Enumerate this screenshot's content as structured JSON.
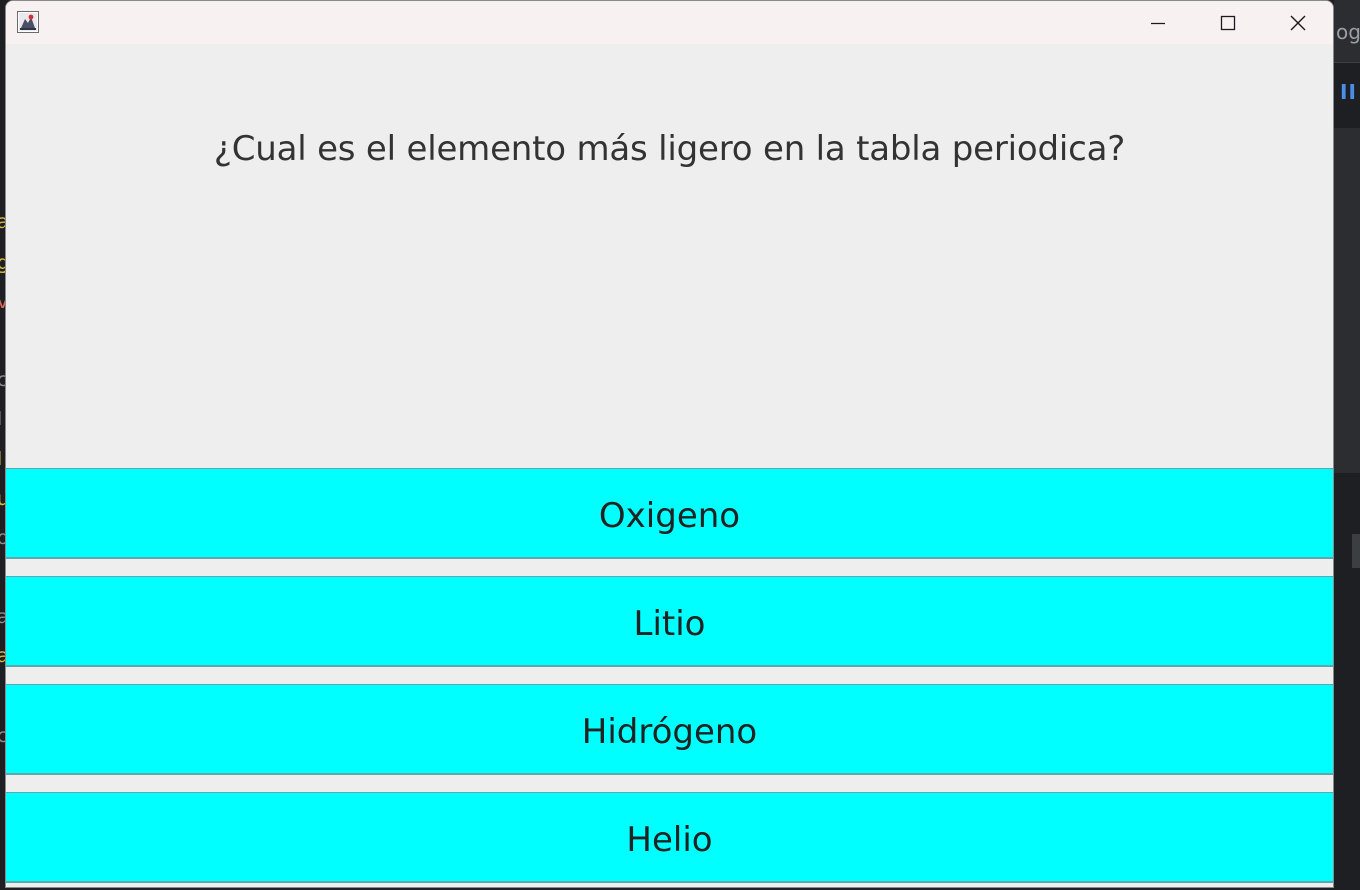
{
  "window": {
    "question": "¿Cual es el elemento más ligero en la tabla periodica?",
    "answers": [
      {
        "label": "Oxigeno"
      },
      {
        "label": "Litio"
      },
      {
        "label": "Hidrógeno"
      },
      {
        "label": "Helio"
      }
    ],
    "answer_color": "#00ffff",
    "background_color": "#eeeeee"
  },
  "titlebar": {
    "icon": "java-app-icon",
    "controls": [
      "minimize-icon",
      "maximize-icon",
      "close-icon"
    ]
  },
  "background_fragments": {
    "right_text": "ogc",
    "right_pause": "II",
    "left_letters": [
      "a",
      "g",
      "v",
      "c",
      "l",
      "l",
      "u",
      "o",
      "a",
      "a",
      "c"
    ],
    "left_colors": [
      "#d8b93c",
      "#d8b93c",
      "#e0675c",
      "#8a8d93",
      "#8a8d93",
      "#d8b93c",
      "#d8b93c",
      "#8a8d93",
      "#8a8d93",
      "#d8b93c",
      "#8a8d93"
    ]
  }
}
